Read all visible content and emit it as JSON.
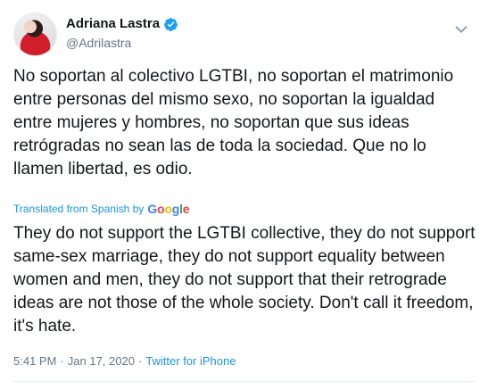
{
  "tweet": {
    "author": {
      "display_name": "Adriana Lastra",
      "handle": "@Adrilastra",
      "verified": true
    },
    "original_text": "No soportan al colectivo LGTBI, no soportan el matrimonio entre personas del mismo sexo, no soportan la igualdad entre mujeres y hombres, no soportan que sus ideas retrógradas no sean las de toda la sociedad. Que no lo llamen libertad, es odio.",
    "translation": {
      "label": "Translated from Spanish by",
      "provider": "Google",
      "text": "They do not support the LGTBI collective, they do not support same-sex marriage, they do not support equality between women and men, they do not support that their retrograde ideas are not those of the whole society. Don't call it freedom, it's hate."
    },
    "meta": {
      "time": "5:41 PM",
      "separator": "·",
      "date": "Jan 17, 2020",
      "source": "Twitter for iPhone"
    }
  },
  "colors": {
    "accent": "#1b95e0",
    "muted": "#657786",
    "text": "#14171a"
  },
  "icons": {
    "verified": "verified-badge-icon",
    "menu": "chevron-down-icon"
  }
}
